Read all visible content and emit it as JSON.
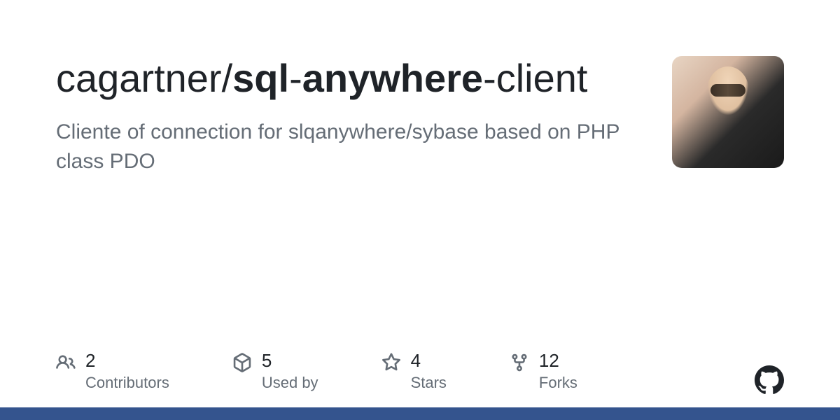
{
  "repo": {
    "owner": "cagartner",
    "separator": "/",
    "name_part1": "sql",
    "name_part2": "-",
    "name_part3": "anywhere",
    "name_part4": "-client",
    "description": "Cliente of connection for slqanywhere/sybase based on PHP class PDO"
  },
  "stats": {
    "contributors": {
      "value": "2",
      "label": "Contributors"
    },
    "usedby": {
      "value": "5",
      "label": "Used by"
    },
    "stars": {
      "value": "4",
      "label": "Stars"
    },
    "forks": {
      "value": "12",
      "label": "Forks"
    }
  }
}
